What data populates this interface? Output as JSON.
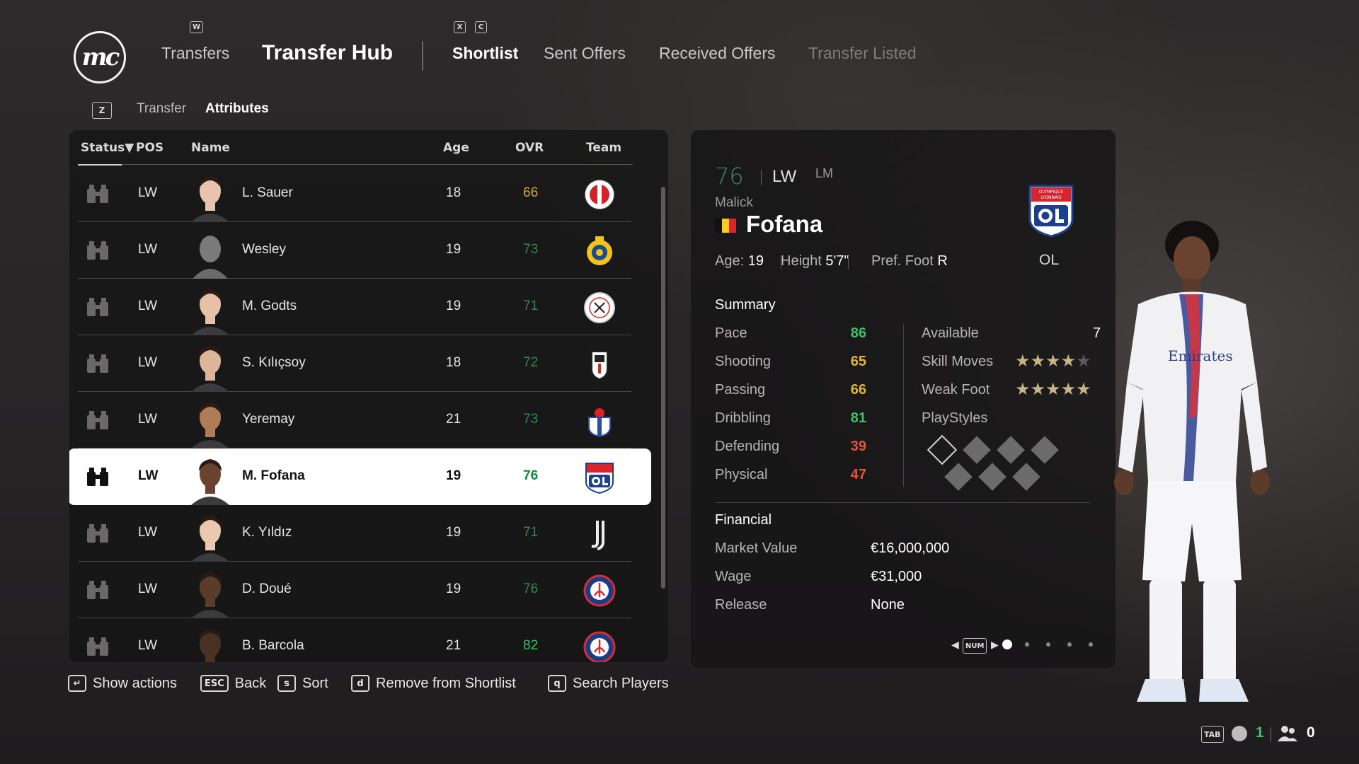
{
  "nav": {
    "logo_text": "mc",
    "left_key": "W",
    "transfers": "Transfers",
    "hub": "Transfer Hub",
    "key_x": "X",
    "key_c": "C",
    "tabs": [
      "Shortlist",
      "Sent Offers",
      "Received Offers",
      "Transfer Listed"
    ]
  },
  "subtabs": {
    "key": "Z",
    "items": [
      "Transfer",
      "Attributes"
    ]
  },
  "table": {
    "headers": {
      "status": "Status",
      "status_arrow": "▼",
      "pos": "POS",
      "name": "Name",
      "age": "Age",
      "ovr": "OVR",
      "team": "Team"
    },
    "rows": [
      {
        "pos": "LW",
        "name": "L. Sauer",
        "age": "18",
        "ovr": "66",
        "ovr_color": "#d6a72e",
        "team": "feyenoord",
        "photo": "face"
      },
      {
        "pos": "LW",
        "name": "Wesley",
        "age": "19",
        "ovr": "73",
        "ovr_color": "#2f8a4d",
        "team": "al-nassr",
        "photo": "silhouette"
      },
      {
        "pos": "LW",
        "name": "M. Godts",
        "age": "19",
        "ovr": "71",
        "ovr_color": "#2f8a4d",
        "team": "ajax",
        "photo": "face"
      },
      {
        "pos": "LW",
        "name": "S. Kılıçsoy",
        "age": "18",
        "ovr": "72",
        "ovr_color": "#2f8a4d",
        "team": "besiktas",
        "photo": "face"
      },
      {
        "pos": "LW",
        "name": "Yeremay",
        "age": "21",
        "ovr": "73",
        "ovr_color": "#2f8a4d",
        "team": "deportivo",
        "photo": "face"
      },
      {
        "pos": "LW",
        "name": "M. Fofana",
        "age": "19",
        "ovr": "76",
        "ovr_color": "#0f8a3a",
        "team": "lyon",
        "photo": "face",
        "selected": true
      },
      {
        "pos": "LW",
        "name": "K. Yıldız",
        "age": "19",
        "ovr": "71",
        "ovr_color": "#2f8a4d",
        "team": "juventus",
        "photo": "face"
      },
      {
        "pos": "LW",
        "name": "D. Doué",
        "age": "19",
        "ovr": "76",
        "ovr_color": "#2f8a4d",
        "team": "psg",
        "photo": "face"
      },
      {
        "pos": "LW",
        "name": "B. Barcola",
        "age": "21",
        "ovr": "82",
        "ovr_color": "#34c160",
        "team": "psg",
        "photo": "face"
      }
    ]
  },
  "actions": [
    {
      "key": "↵",
      "label": "Show actions"
    },
    {
      "key": "ESC",
      "label": "Back"
    },
    {
      "key": "s",
      "label": "Sort"
    },
    {
      "key": "d",
      "label": "Remove from Shortlist"
    },
    {
      "key": "q",
      "label": "Search Players"
    }
  ],
  "player": {
    "ovr": "76",
    "pos": "LW",
    "alt_pos": "LM",
    "first_name": "Malick",
    "last_name": "Fofana",
    "age_label": "Age:",
    "age": "19",
    "height_label": "Height",
    "height": "5'7\"",
    "foot_label": "Pref. Foot",
    "foot": "R",
    "club": "OL",
    "club_crest_text": "OLYMPIQUE LYONNAIS",
    "summary_title": "Summary",
    "stats": [
      {
        "label": "Pace",
        "value": "86",
        "color": "#3ec26a"
      },
      {
        "label": "Shooting",
        "value": "65",
        "color": "#e4b43a"
      },
      {
        "label": "Passing",
        "value": "66",
        "color": "#e4b43a"
      },
      {
        "label": "Dribbling",
        "value": "81",
        "color": "#3ec26a"
      },
      {
        "label": "Defending",
        "value": "39",
        "color": "#e0563a"
      },
      {
        "label": "Physical",
        "value": "47",
        "color": "#e0563a"
      }
    ],
    "available_label": "Available",
    "available": "7",
    "skill_label": "Skill Moves",
    "skill_stars": 4,
    "weak_label": "Weak Foot",
    "weak_stars": 5,
    "playstyles_label": "PlayStyles",
    "financial_title": "Financial",
    "financial": [
      {
        "label": "Market Value",
        "value": "€16,000,000"
      },
      {
        "label": "Wage",
        "value": "€31,000"
      },
      {
        "label": "Release",
        "value": "None"
      }
    ],
    "pager_key": "NUM",
    "pager_pages": 5,
    "pager_current": 1
  },
  "hud": {
    "tab_key": "TAB",
    "count1": "1",
    "count2": "0"
  }
}
